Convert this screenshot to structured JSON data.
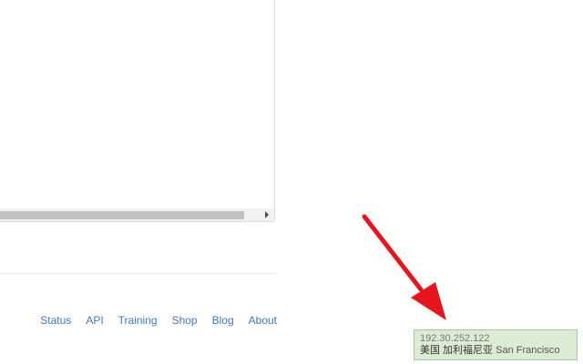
{
  "footer": {
    "links": [
      "Status",
      "API",
      "Training",
      "Shop",
      "Blog",
      "About"
    ]
  },
  "ip_tooltip": {
    "ip": "192.30.252.122",
    "location_cn": "美国 加利福尼亚",
    "city": "San Francisco"
  },
  "colors": {
    "link": "#4078c0",
    "arrow": "#e8141c",
    "tooltip_bg": "#dcecd4",
    "tooltip_border": "#a9c59d",
    "scroll_thumb": "#c1c1c1"
  },
  "icons": {
    "scroll_right": "triangle-right-icon",
    "annotation": "red-arrow-icon"
  }
}
